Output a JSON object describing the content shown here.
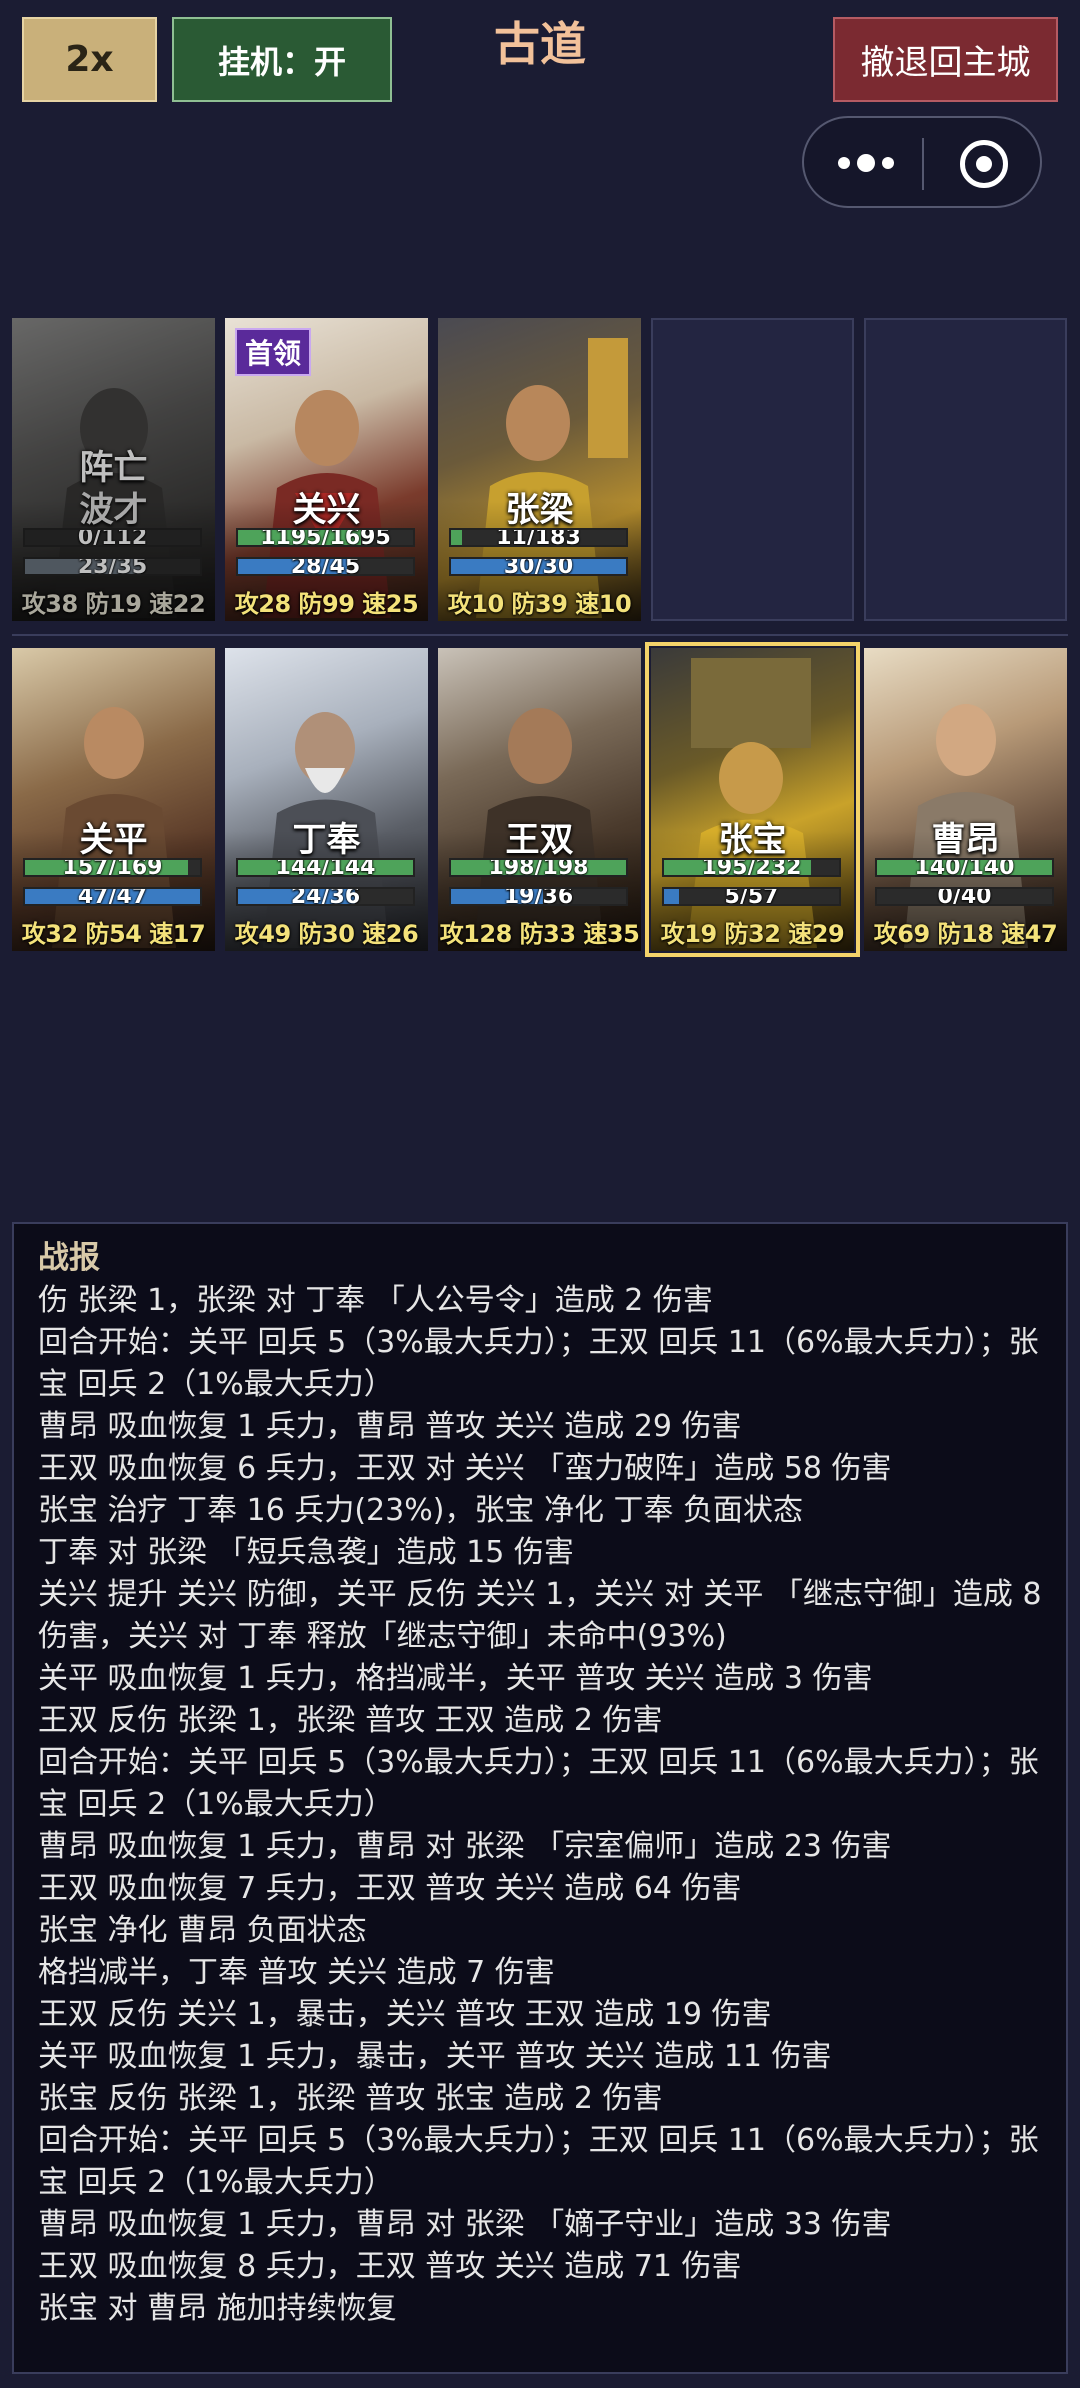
{
  "header": {
    "speed_label": "2x",
    "auto_label": "挂机：开",
    "stage_title": "古道",
    "retreat_label": "撤退回主城"
  },
  "enemy_team": [
    {
      "name": "阵亡",
      "subname": "波才",
      "hp": "0/112",
      "hp_ratio": 0,
      "troops": "23/35",
      "troops_ratio": 0.657,
      "stats": "攻38 防19 速22",
      "dead": true
    },
    {
      "name": "关兴",
      "tag": "首领",
      "hp": "1195/1695",
      "hp_ratio": 0.705,
      "troops": "28/45",
      "troops_ratio": 0.622,
      "stats": "攻28 防99 速25"
    },
    {
      "name": "张梁",
      "hp": "11/183",
      "hp_ratio": 0.06,
      "troops": "30/30",
      "troops_ratio": 1.0,
      "stats": "攻10 防39 速10"
    }
  ],
  "player_team": [
    {
      "name": "关平",
      "hp": "157/169",
      "hp_ratio": 0.929,
      "troops": "47/47",
      "troops_ratio": 1.0,
      "stats": "攻32 防54 速17"
    },
    {
      "name": "丁奉",
      "hp": "144/144",
      "hp_ratio": 1.0,
      "troops": "24/36",
      "troops_ratio": 0.667,
      "stats": "攻49 防30 速26"
    },
    {
      "name": "王双",
      "hp": "198/198",
      "hp_ratio": 1.0,
      "troops": "19/36",
      "troops_ratio": 0.528,
      "stats": "攻128 防33 速35"
    },
    {
      "name": "张宝",
      "hp": "195/232",
      "hp_ratio": 0.84,
      "troops": "5/57",
      "troops_ratio": 0.088,
      "stats": "攻19 防32 速29",
      "selected": true
    },
    {
      "name": "曹昂",
      "hp": "140/140",
      "hp_ratio": 1.0,
      "troops": "0/40",
      "troops_ratio": 0,
      "stats": "攻69 防18 速47"
    }
  ],
  "battle_log": {
    "title": "战报",
    "lines": [
      "伤 张梁 1，张梁 对 丁奉 「人公号令」造成 2 伤害",
      "回合开始：关平 回兵 5（3%最大兵力）；王双 回兵 11（6%最大兵力）；张宝 回兵 2（1%最大兵力）",
      "曹昂 吸血恢复 1 兵力，曹昂 普攻 关兴 造成 29 伤害",
      "王双 吸血恢复 6 兵力，王双 对 关兴 「蛮力破阵」造成 58 伤害",
      "张宝 治疗 丁奉 16 兵力(23%)，张宝 净化 丁奉 负面状态",
      "丁奉 对 张梁 「短兵急袭」造成 15 伤害",
      "关兴 提升 关兴 防御，关平 反伤 关兴 1，关兴 对 关平 「继志守御」造成 8 伤害，关兴 对 丁奉 释放「继志守御」未命中(93%)",
      "关平 吸血恢复 1 兵力，格挡减半，关平 普攻 关兴 造成 3 伤害",
      "王双 反伤 张梁 1，张梁 普攻 王双 造成 2 伤害",
      "回合开始：关平 回兵 5（3%最大兵力）；王双 回兵 11（6%最大兵力）；张宝 回兵 2（1%最大兵力）",
      "曹昂 吸血恢复 1 兵力，曹昂 对 张梁 「宗室偏师」造成 23 伤害",
      "王双 吸血恢复 7 兵力，王双 普攻 关兴 造成 64 伤害",
      "张宝 净化 曹昂 负面状态",
      "格挡减半，丁奉 普攻 关兴 造成 7 伤害",
      "王双 反伤 关兴 1，暴击，关兴 普攻 王双 造成 19 伤害",
      "关平 吸血恢复 1 兵力，暴击，关平 普攻 关兴 造成 11 伤害",
      "张宝 反伤 张梁 1，张梁 普攻 张宝 造成 2 伤害",
      "回合开始：关平 回兵 5（3%最大兵力）；王双 回兵 11（6%最大兵力）；张宝 回兵 2（1%最大兵力）",
      "曹昂 吸血恢复 1 兵力，曹昂 对 张梁 「嫡子守业」造成 33 伤害",
      "王双 吸血恢复 8 兵力，王双 普攻 关兴 造成 71 伤害",
      "张宝 对 曹昂 施加持续恢复"
    ]
  }
}
